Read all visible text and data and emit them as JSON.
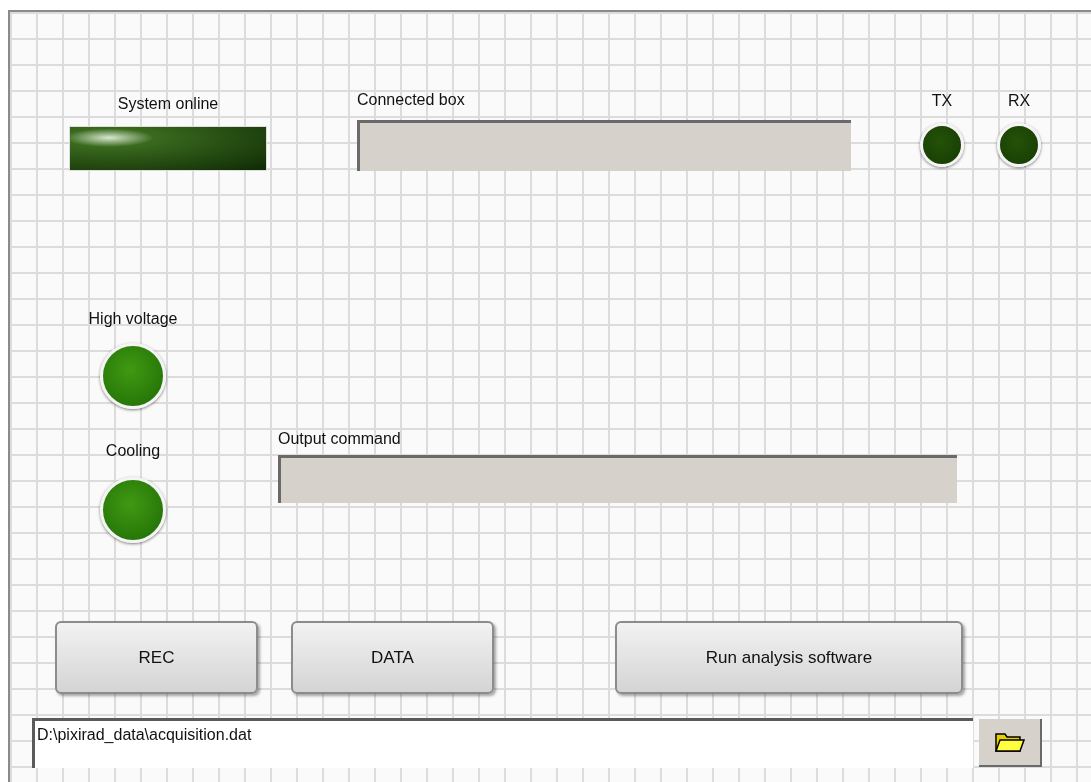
{
  "system_online": {
    "label": "System online",
    "on": false
  },
  "connected_box": {
    "label": "Connected box"
  },
  "indicators": [
    {
      "label": "TX",
      "on": false
    },
    {
      "label": "RX",
      "on": false
    }
  ],
  "status_leds": [
    {
      "label": "High voltage",
      "on": true
    },
    {
      "label": "Cooling",
      "on": true
    }
  ],
  "output_command": {
    "label": "Output command"
  },
  "buttons": [
    {
      "label": "REC",
      "kind": "small"
    },
    {
      "label": "DATA",
      "kind": "small"
    },
    {
      "label": "Run analysis software",
      "kind": "wide"
    }
  ],
  "path": {
    "value": "D:\\pixirad_data\\acquisition.dat"
  }
}
